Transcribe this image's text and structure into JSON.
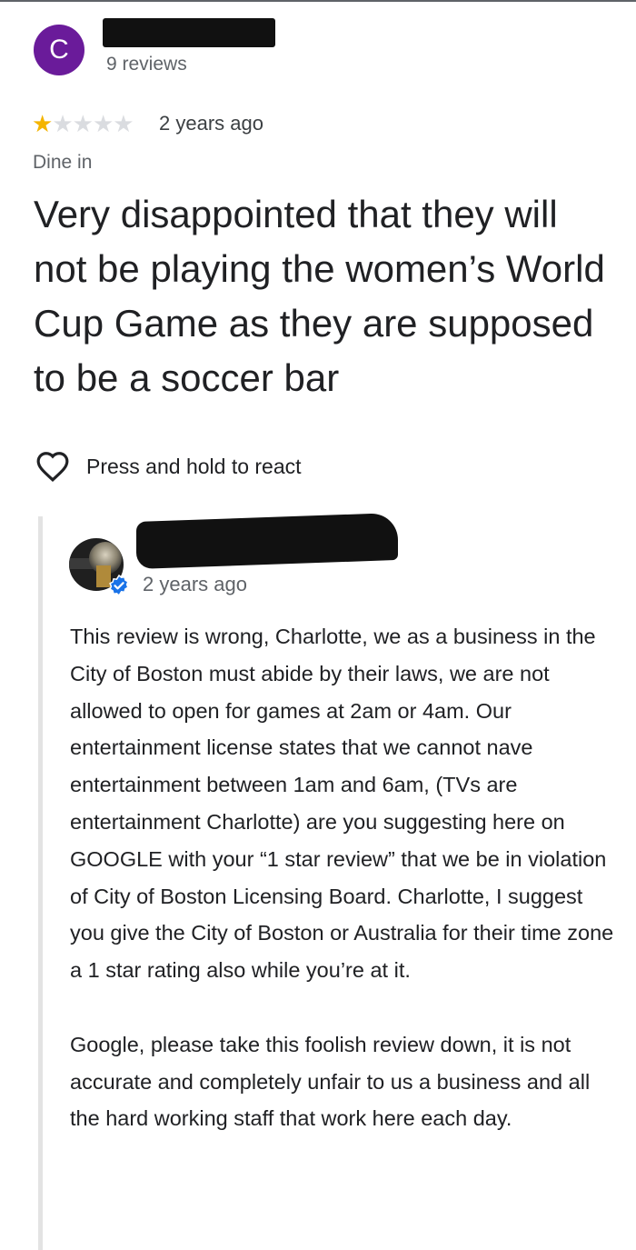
{
  "reviewer": {
    "avatar_initial": "C",
    "avatar_color": "#6a1b9a",
    "review_count": "9 reviews"
  },
  "review": {
    "rating": 1,
    "rating_max": 5,
    "star_color": "#f4b400",
    "time": "2 years ago",
    "service_tag": "Dine in",
    "text": "Very disappointed that they will not be playing the women’s World Cup Game as they are supposed to be a soccer bar",
    "react_icon": "heart-outline-icon",
    "react_label": "Press and hold to react"
  },
  "owner_reply": {
    "verified_icon": "verified-badge-icon",
    "verified_color": "#1a73e8",
    "time": "2 years ago",
    "paragraphs": [
      "This review is wrong, Charlotte, we as a business in the City of Boston must abide by their laws, we are not allowed to open for games at 2am or 4am. Our entertainment license states that we cannot nave entertainment between 1am and 6am, (TVs are entertainment Charlotte) are you suggesting here on GOOGLE with your “1 star review” that we be in violation of City of Boston Licensing Board. Charlotte, I suggest you give the City of Boston or Australia for their time zone a 1 star rating also while you’re at it.",
      "Google, please take this foolish review down, it is not accurate and completely unfair to us a business and all the hard working staff that work here each day."
    ]
  }
}
